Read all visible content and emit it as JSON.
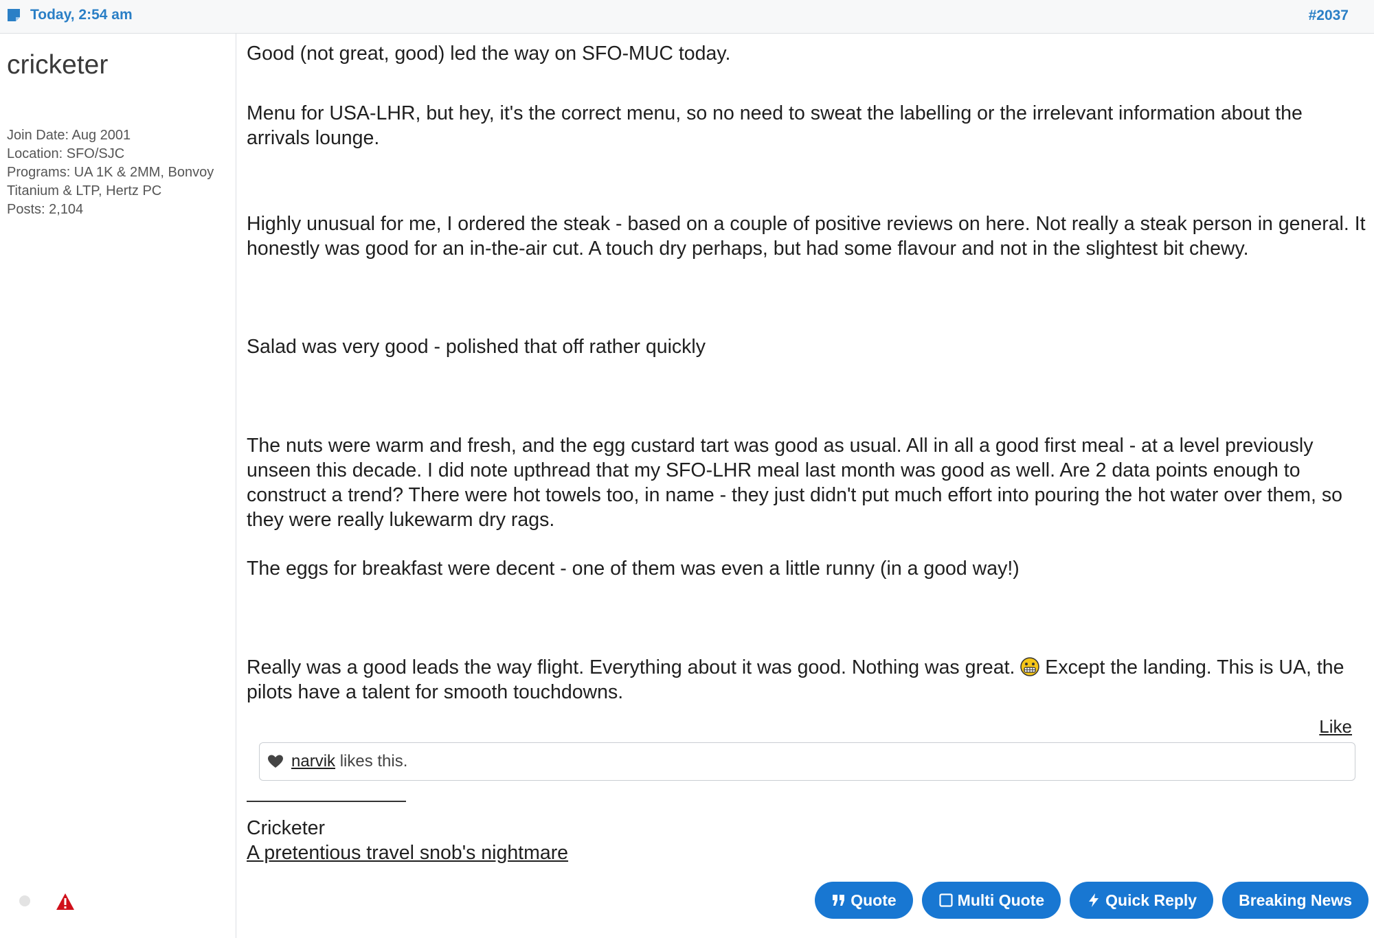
{
  "header": {
    "date": "Today, 2:54 am",
    "post_number": "#2037"
  },
  "user": {
    "name": "cricketer",
    "join_date": "Join Date: Aug 2001",
    "location": "Location: SFO/SJC",
    "programs": "Programs: UA 1K & 2MM, Bonvoy Titanium & LTP, Hertz PC",
    "posts": "Posts: 2,104"
  },
  "post": {
    "p1": "Good (not great, good) led the way on SFO-MUC today.",
    "p2": "Menu for USA-LHR, but hey, it's the correct menu, so no need to sweat the labelling or the irrelevant information about the arrivals lounge.",
    "p3": "Highly unusual for me, I ordered the steak - based on a couple of positive reviews on here. Not really a steak person in general. It honestly was good for an in-the-air cut. A touch dry perhaps, but had some flavour and not in the slightest bit chewy.",
    "p4": "Salad was very good - polished that off rather quickly",
    "p5": "The nuts were warm and fresh, and the egg custard tart was good as usual. All in all a good first meal - at a level previously unseen this decade. I did note upthread that my SFO-LHR meal last month was good as well. Are 2 data points enough to construct a trend? There were hot towels too, in name - they just didn't put much effort into pouring the hot water over them, so they were really lukewarm dry rags.",
    "p6": "The eggs for breakfast were decent - one of them was even a little runny (in a good way!)",
    "p7a": "Really was a good leads the way flight. Everything about it was good. Nothing was great. ",
    "p7b": " Except the landing. This is UA, the pilots have a talent for smooth touchdowns."
  },
  "like_label": "Like",
  "likes": {
    "user": "narvik",
    "text": " likes this."
  },
  "signature": {
    "rule": "________________",
    "name": "Cricketer",
    "link": "A pretentious travel snob's nightmare"
  },
  "actions": {
    "quote": "Quote",
    "multi_quote": "Multi Quote",
    "quick_reply": "Quick Reply",
    "breaking_news": "Breaking News"
  },
  "colors": {
    "accent": "#2a7fc6",
    "button": "#1877d2",
    "warning": "#d0101b"
  }
}
